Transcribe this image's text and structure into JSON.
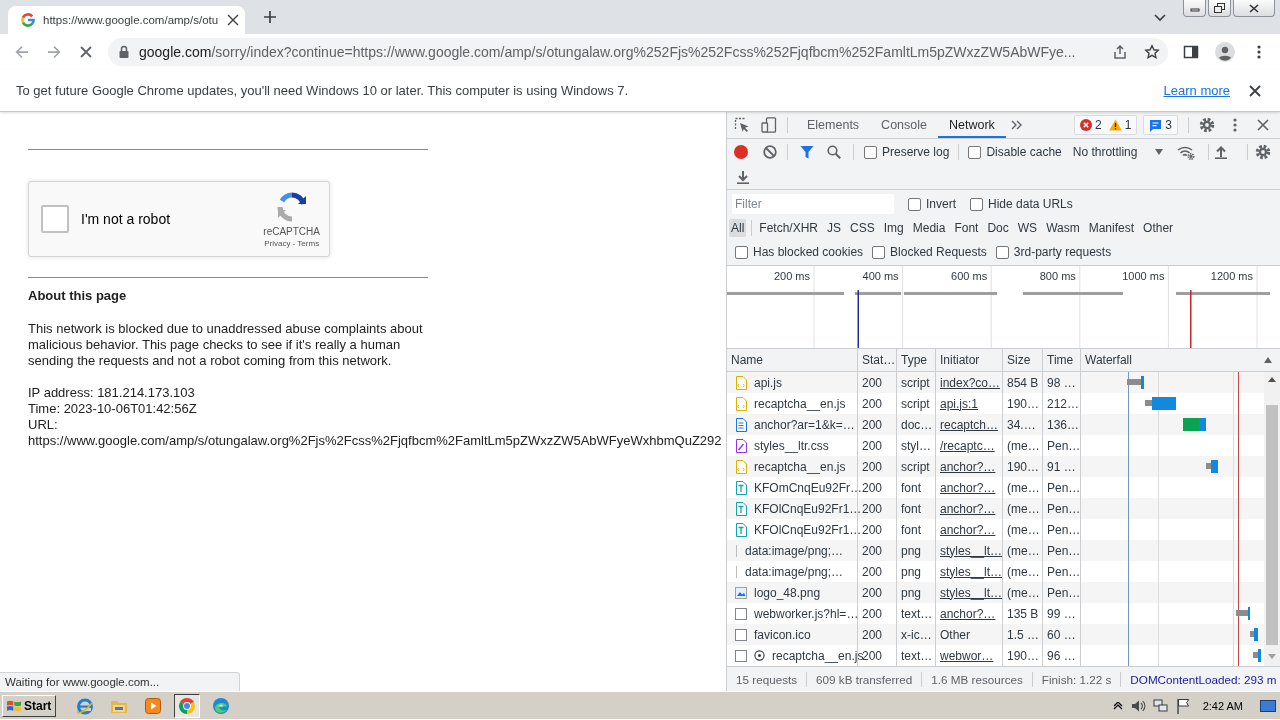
{
  "browser": {
    "tab": {
      "title": "https://www.google.com/amp/s/otu",
      "selected": true
    },
    "omnibox": {
      "host": "google.com",
      "rest": "/sorry/index?continue=https://www.google.com/amp/s/otungalaw.org%252Fjs%252Fcss%252Fjqfbcm%252FamltLm5pZWxzZW5AbWFye..."
    },
    "infobar": {
      "message": "To get future Google Chrome updates, you'll need Windows 10 or later. This computer is using Windows 7.",
      "link": "Learn more"
    }
  },
  "page": {
    "captcha": {
      "label": "I'm not a robot",
      "checked": false,
      "brand": "reCAPTCHA",
      "links": "Privacy - Terms"
    },
    "heading": "About this page",
    "paragraph": "This network is blocked due to unaddressed abuse complaints about malicious behavior. This page checks to see if it's really a human sending the requests and not a robot coming from this network.",
    "details": [
      "IP address: 181.214.173.103",
      "Time: 2023-10-06T01:42:56Z",
      "URL:",
      "https://www.google.com/amp/s/otungalaw.org%2Fjs%2Fcss%2Fjqfbcm%2FamltLm5pZWxzZW5AbWFyeWxhbmQuZ292"
    ]
  },
  "status_bubble": "Waiting for www.google.com...",
  "devtools": {
    "tabs": [
      {
        "label": "Elements",
        "selected": false
      },
      {
        "label": "Console",
        "selected": false
      },
      {
        "label": "Network",
        "selected": true
      }
    ],
    "issues": {
      "errors": "2",
      "warnings": "1",
      "messages": "3"
    },
    "recording": true,
    "preserve_log": {
      "label": "Preserve log",
      "checked": false
    },
    "disable_cache": {
      "label": "Disable cache",
      "checked": false
    },
    "throttling": "No throttling",
    "filter": {
      "placeholder": "Filter",
      "options": [
        {
          "label": "Invert",
          "checked": false
        },
        {
          "label": "Hide data URLs",
          "checked": false
        }
      ]
    },
    "types": [
      {
        "label": "All",
        "selected": true
      },
      {
        "label": "Fetch/XHR",
        "selected": false
      },
      {
        "label": "JS",
        "selected": false
      },
      {
        "label": "CSS",
        "selected": false
      },
      {
        "label": "Img",
        "selected": false
      },
      {
        "label": "Media",
        "selected": false
      },
      {
        "label": "Font",
        "selected": false
      },
      {
        "label": "Doc",
        "selected": false
      },
      {
        "label": "WS",
        "selected": false
      },
      {
        "label": "Wasm",
        "selected": false
      },
      {
        "label": "Manifest",
        "selected": false
      },
      {
        "label": "Other",
        "selected": false
      }
    ],
    "more_filters": [
      {
        "label": "Has blocked cookies",
        "checked": false
      },
      {
        "label": "Blocked Requests",
        "checked": false
      },
      {
        "label": "3rd-party requests",
        "checked": false
      }
    ],
    "overview": {
      "ticks": [
        "200 ms",
        "400 ms",
        "600 ms",
        "800 ms",
        "1000 ms",
        "1200 ms"
      ]
    },
    "table": {
      "columns": [
        "Name",
        "Stat…",
        "Type",
        "Initiator",
        "Size",
        "Time",
        "Waterfall"
      ],
      "rows": [
        {
          "kind": "script",
          "name": "api.js",
          "status": "200",
          "type": "script",
          "initiator": "index?co…",
          "initiator_is_link": true,
          "size": "854 B",
          "time": "98 …",
          "from_worker": false
        },
        {
          "kind": "script",
          "name": "recaptcha__en.js",
          "status": "200",
          "type": "script",
          "initiator": "api.js:1",
          "initiator_is_link": true,
          "size": "190…",
          "time": "212…",
          "from_worker": false
        },
        {
          "kind": "document",
          "name": "anchor?ar=1&k=…",
          "status": "200",
          "type": "doc…",
          "initiator": "recaptch…",
          "initiator_is_link": true,
          "size": "34.…",
          "time": "136…",
          "from_worker": false
        },
        {
          "kind": "stylesheet",
          "name": "styles__ltr.css",
          "status": "200",
          "type": "styl…",
          "initiator": "/recaptc…",
          "initiator_is_link": true,
          "size": "(me…",
          "time": "Pen…",
          "from_worker": false
        },
        {
          "kind": "script",
          "name": "recaptcha__en.js",
          "status": "200",
          "type": "script",
          "initiator": "anchor?…",
          "initiator_is_link": true,
          "size": "190…",
          "time": "91 …",
          "from_worker": false
        },
        {
          "kind": "font",
          "name": "KFOmCnqEu92Fr…",
          "status": "200",
          "type": "font",
          "initiator": "anchor?…",
          "initiator_is_link": true,
          "size": "(me…",
          "time": "Pen…",
          "from_worker": false
        },
        {
          "kind": "font",
          "name": "KFOlCnqEu92Fr1…",
          "status": "200",
          "type": "font",
          "initiator": "anchor?…",
          "initiator_is_link": true,
          "size": "(me…",
          "time": "Pen…",
          "from_worker": false
        },
        {
          "kind": "font",
          "name": "KFOlCnqEu92Fr1…",
          "status": "200",
          "type": "font",
          "initiator": "anchor?…",
          "initiator_is_link": true,
          "size": "(me…",
          "time": "Pen…",
          "from_worker": false
        },
        {
          "kind": "data_image",
          "name": "data:image/png;…",
          "status": "200",
          "type": "png",
          "initiator": "styles__lt…",
          "initiator_is_link": true,
          "size": "(me…",
          "time": "Pen…",
          "from_worker": false
        },
        {
          "kind": "data_image",
          "name": "data:image/png;…",
          "status": "200",
          "type": "png",
          "initiator": "styles__lt…",
          "initiator_is_link": true,
          "size": "(me…",
          "time": "Pen…",
          "from_worker": false
        },
        {
          "kind": "image",
          "name": "logo_48.png",
          "status": "200",
          "type": "png",
          "initiator": "styles__lt…",
          "initiator_is_link": true,
          "size": "(me…",
          "time": "Pen…",
          "from_worker": false
        },
        {
          "kind": "file",
          "name": "webworker.js?hl=…",
          "status": "200",
          "type": "text…",
          "initiator": "anchor?…",
          "initiator_is_link": true,
          "size": "135 B",
          "time": "99 …",
          "from_worker": false
        },
        {
          "kind": "file",
          "name": "favicon.ico",
          "status": "200",
          "type": "x-ic…",
          "initiator": "Other",
          "initiator_is_link": false,
          "size": "1.5 …",
          "time": "60 …",
          "from_worker": false
        },
        {
          "kind": "file",
          "name": "recaptcha__en.js",
          "status": "200",
          "type": "text…",
          "initiator": "webwor…",
          "initiator_is_link": true,
          "size": "190…",
          "time": "96 …",
          "from_worker": true
        }
      ]
    },
    "summary": [
      {
        "text": "15 requests",
        "color": "#5f6368"
      },
      {
        "text": "609 kB transferred",
        "color": "#5f6368"
      },
      {
        "text": "1.6 MB resources",
        "color": "#5f6368"
      },
      {
        "text": "Finish: 1.22 s",
        "color": "#5f6368"
      },
      {
        "text": "DOMContentLoaded: 293 m",
        "color": "#1a1aa6"
      }
    ]
  },
  "taskbar": {
    "start": "Start",
    "apps": [
      {
        "selected": false
      },
      {
        "selected": false
      },
      {
        "selected": false
      },
      {
        "selected": true
      },
      {
        "selected": false
      }
    ],
    "clock": "2:42 AM"
  }
}
